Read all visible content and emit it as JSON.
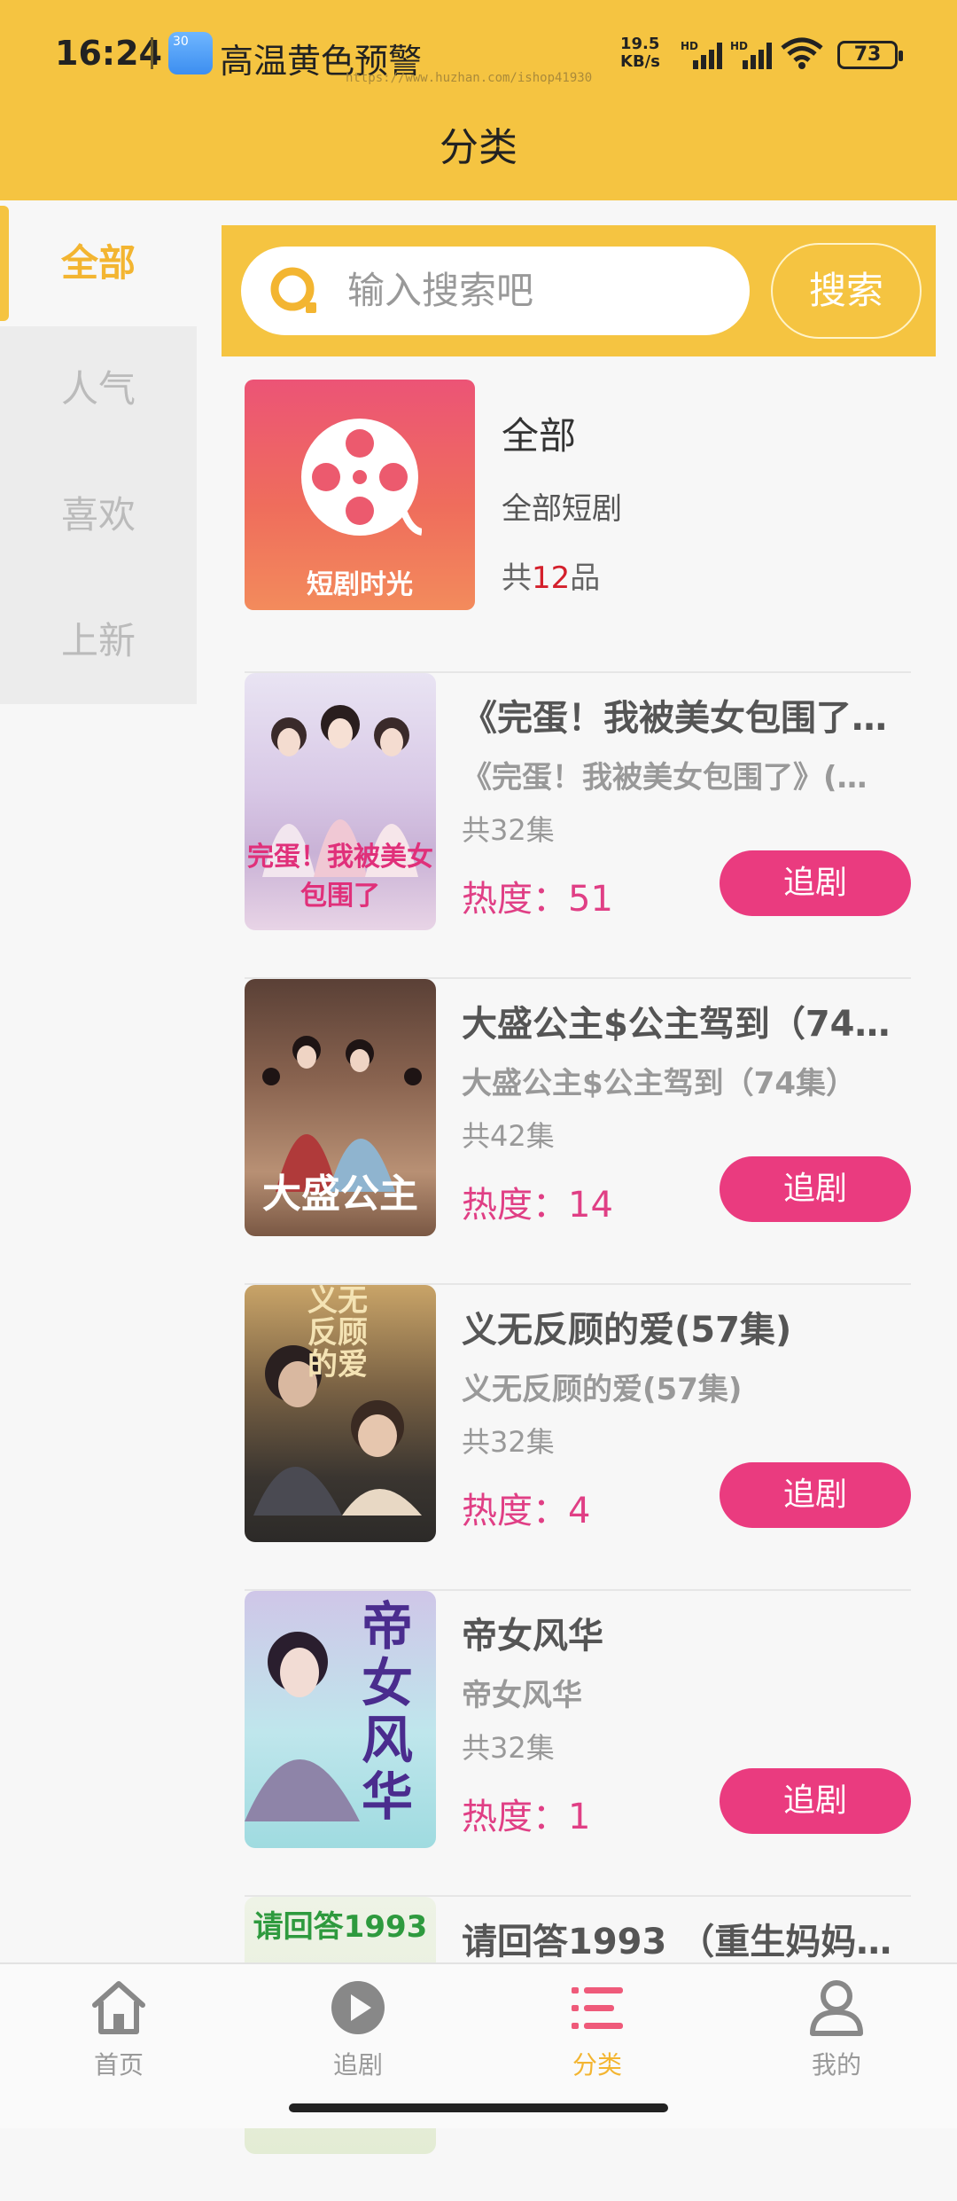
{
  "status": {
    "time": "16:24",
    "weather_temp": "30",
    "weather_text": "高温黄色预警",
    "watermark": "https://www.huzhan.com/ishop41930",
    "speed_value": "19.5",
    "speed_unit": "KB/s",
    "battery": "73"
  },
  "header": {
    "title": "分类"
  },
  "sidebar": {
    "items": [
      {
        "label": "全部",
        "active": true
      },
      {
        "label": "人气"
      },
      {
        "label": "喜欢"
      },
      {
        "label": "上新"
      }
    ]
  },
  "search": {
    "placeholder": "输入搜索吧",
    "button": "搜索"
  },
  "category": {
    "cover_text": "短剧时光",
    "name": "全部",
    "desc": "全部短剧",
    "count_prefix": "共",
    "count": "12",
    "count_suffix": "品"
  },
  "items": [
    {
      "title": "《完蛋！我被美女包围了》(…",
      "subtitle": "《完蛋！我被美女包围了》(…",
      "episodes": "共32集",
      "heat": "热度：51",
      "button": "追剧",
      "cover_caption": "完蛋！我被美女包围了"
    },
    {
      "title": "大盛公主$公主驾到（74集）",
      "subtitle": "大盛公主$公主驾到（74集）",
      "episodes": "共42集",
      "heat": "热度：14",
      "button": "追剧",
      "cover_caption": "大盛公主"
    },
    {
      "title": "义无反顾的爱(57集)",
      "subtitle": "义无反顾的爱(57集)",
      "episodes": "共32集",
      "heat": "热度：4",
      "button": "追剧",
      "cover_caption": "义无反顾的爱"
    },
    {
      "title": "帝女风华",
      "subtitle": "帝女风华",
      "episodes": "共32集",
      "heat": "热度：1",
      "button": "追剧",
      "cover_caption": "帝女风华"
    },
    {
      "title": "请回答1993 （重生妈妈…",
      "cover_caption": "请回答1993"
    }
  ],
  "tabbar": {
    "tabs": [
      {
        "label": "首页",
        "icon": "home-icon"
      },
      {
        "label": "追剧",
        "icon": "play-icon"
      },
      {
        "label": "分类",
        "icon": "category-list-icon",
        "active": true
      },
      {
        "label": "我的",
        "icon": "user-icon"
      }
    ]
  },
  "colors": {
    "brand": "#f5c441",
    "accent": "#ea3b7f",
    "active_text": "#f3b531"
  }
}
